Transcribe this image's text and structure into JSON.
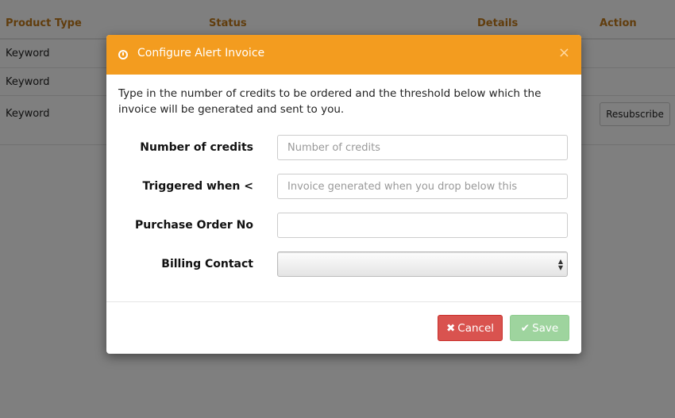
{
  "table": {
    "headers": {
      "product_type": "Product Type",
      "status": "Status",
      "details": "Details",
      "action": "Action"
    },
    "rows": [
      {
        "product_type": "Keyword"
      },
      {
        "product_type": "Keyword"
      },
      {
        "product_type": "Keyword",
        "action_label": "Resubscribe"
      }
    ]
  },
  "modal": {
    "title": "Configure Alert Invoice",
    "close_glyph": "×",
    "intro": "Type in the number of credits to be ordered and the threshold below which the invoice will be generated and sent to you.",
    "fields": {
      "credits": {
        "label": "Number of credits",
        "value": "",
        "placeholder": "Number of credits"
      },
      "triggered": {
        "label": "Triggered when <",
        "value": "",
        "placeholder": "Invoice generated when you drop below this"
      },
      "po": {
        "label": "Purchase Order No",
        "value": "",
        "placeholder": ""
      },
      "billing": {
        "label": "Billing Contact",
        "selected": ""
      }
    },
    "buttons": {
      "cancel": {
        "label": "Cancel",
        "icon": "times-icon",
        "glyph": "✖"
      },
      "save": {
        "label": "Save",
        "icon": "check-icon",
        "glyph": "✔"
      }
    }
  },
  "colors": {
    "header_orange": "#f39c1f",
    "table_header_text": "#c27a1a",
    "cancel_red": "#d9534f",
    "save_green_disabled": "#9ed49e"
  }
}
